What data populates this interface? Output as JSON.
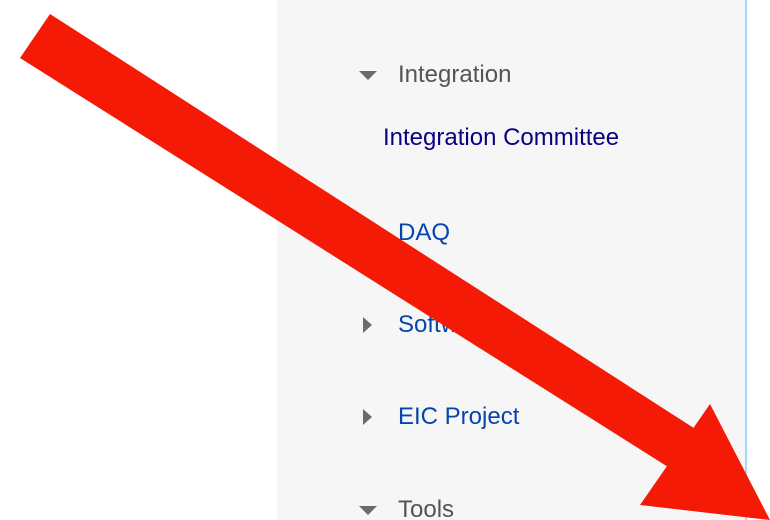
{
  "sidebar": {
    "sections": [
      {
        "label": "Integration",
        "expanded": true,
        "icon": "triangle-down-icon"
      },
      {
        "label": "DAQ",
        "expanded": false,
        "icon": "triangle-right-icon"
      },
      {
        "label": "Software",
        "expanded": false,
        "icon": "triangle-right-icon"
      },
      {
        "label": "EIC Project",
        "expanded": false,
        "icon": "triangle-right-icon"
      },
      {
        "label": "Tools",
        "expanded": true,
        "icon": "triangle-down-icon"
      }
    ],
    "sub_links": {
      "integration_committee": "Integration Committee"
    }
  },
  "colors": {
    "sidebar_bg": "#f6f6f6",
    "sidebar_border": "#a7d7f9",
    "link": "#0645ad",
    "visited_link": "#0b0080",
    "heading": "#545454",
    "annotation_arrow": "#f41a06"
  },
  "annotation": {
    "type": "arrow",
    "icon": "red-arrow-icon",
    "direction": "down-right"
  }
}
